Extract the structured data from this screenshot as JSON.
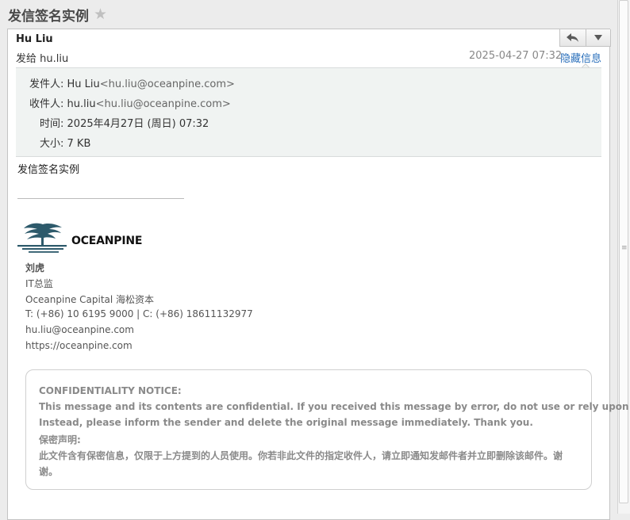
{
  "page": {
    "subject": "发信签名实例"
  },
  "message": {
    "from_name": "Hu Liu",
    "to_line": "发给 hu.liu",
    "date": "2025-04-27 07:32",
    "hide_details_link": "隐藏信息",
    "details": {
      "from_label": "发件人:",
      "from_name": "Hu Liu",
      "from_email": "<hu.liu@oceanpine.com>",
      "to_label": "收件人:",
      "to_name": "hu.liu",
      "to_email": "<hu.liu@oceanpine.com>",
      "time_label": "时间:",
      "time_value": "2025年4月27日 (周日) 07:32",
      "size_label": "大小:",
      "size_value": "7 KB"
    },
    "body_text": "发信签名实例"
  },
  "signature": {
    "logo_text": "OCEANPINE",
    "name": "刘虎",
    "title": "IT总监",
    "company": "Oceanpine Capital 海松资本",
    "phone": "T: (+86) 10 6195 9000 | C: (+86) 18611132977",
    "email": "hu.liu@oceanpine.com",
    "website": "https://oceanpine.com"
  },
  "notice": {
    "heading": "CONFIDENTIALITY NOTICE:",
    "line1": "This message and its contents are confidential. If you received this message by error, do not use or rely upon it.",
    "line2": "Instead, please inform the sender and delete the original message immediately. Thank you.",
    "heading_cn": "保密声明:",
    "line3": "此文件含有保密信息，仅限于上方提到的人员使用。你若非此文件的指定收件人，请立即通知发邮件者并立即删除该邮件。谢",
    "line4": "谢。"
  },
  "icons": {
    "star": "star-icon",
    "reply": "reply-icon",
    "more": "chevron-down-icon"
  },
  "colors": {
    "link": "#2a6fbb",
    "details_bg": "#f0f3f2",
    "logo": "#2d5a6b"
  }
}
